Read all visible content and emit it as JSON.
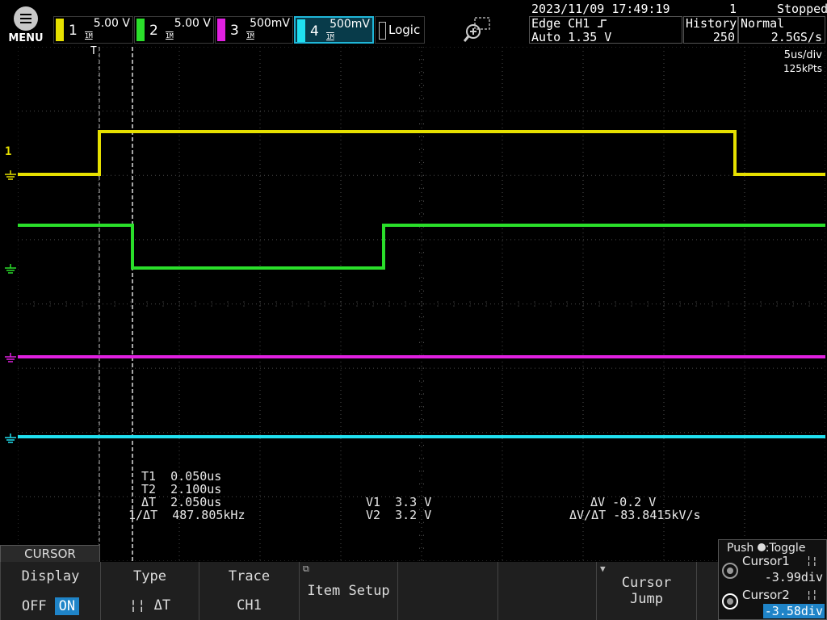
{
  "menu": {
    "label": "MENU"
  },
  "channels": [
    {
      "id": "1",
      "scale": "5.00 V",
      "coupling": "1M",
      "color": "#e6e000"
    },
    {
      "id": "2",
      "scale": "5.00 V",
      "coupling": "1M",
      "color": "#2adf2a"
    },
    {
      "id": "3",
      "scale": "500mV",
      "coupling": "1M",
      "color": "#e020e0"
    },
    {
      "id": "4",
      "scale": "500mV",
      "coupling": "1M",
      "color": "#20e0f0"
    }
  ],
  "logic": {
    "label": "Logic"
  },
  "status": {
    "datetime": "2023/11/09 17:49:19",
    "acq_count": "1",
    "run_state": "Stopped"
  },
  "trigger": {
    "line1": "Edge CH1",
    "line2": "Auto 1.35 V",
    "slope_icon": "rising-edge-icon"
  },
  "history": {
    "label": "History",
    "value": "250"
  },
  "acq_mode": {
    "label": "Normal",
    "rate": "2.5GS/s"
  },
  "timebase": {
    "tdiv": "5us/div",
    "points": "125kPts"
  },
  "measurements": {
    "t1_label": "T1",
    "t1": "0.050us",
    "t2_label": "T2",
    "t2": "2.100us",
    "dt_label": "ΔT",
    "dt": "2.050us",
    "inv_dt_label": "1/ΔT",
    "inv_dt": "487.805kHz",
    "v1_label": "V1",
    "v1": "3.3 V",
    "v2_label": "V2",
    "v2": "3.2 V",
    "dv_label": "ΔV",
    "dv": "-0.2 V",
    "dvdt_label": "ΔV/ΔT",
    "dvdt": "-83.8415kV/s"
  },
  "softkeys": {
    "title": "CURSOR",
    "display": {
      "label": "Display",
      "off": "OFF",
      "on": "ON"
    },
    "type": {
      "label": "Type",
      "value": "ΔT"
    },
    "trace": {
      "label": "Trace",
      "value": "CH1"
    },
    "item_setup": {
      "label": "Item Setup"
    },
    "cursor_jump": {
      "line1": "Cursor",
      "line2": "Jump"
    }
  },
  "cursor_panel": {
    "push_label": "Push",
    "toggle_label": ":Toggle",
    "cursor1_label": "Cursor1",
    "cursor1_value": "-3.99div",
    "cursor2_label": "Cursor2",
    "cursor2_value": "-3.58div"
  },
  "trace_markers": {
    "trigger_marker": "T",
    "trigger_level": "1"
  }
}
